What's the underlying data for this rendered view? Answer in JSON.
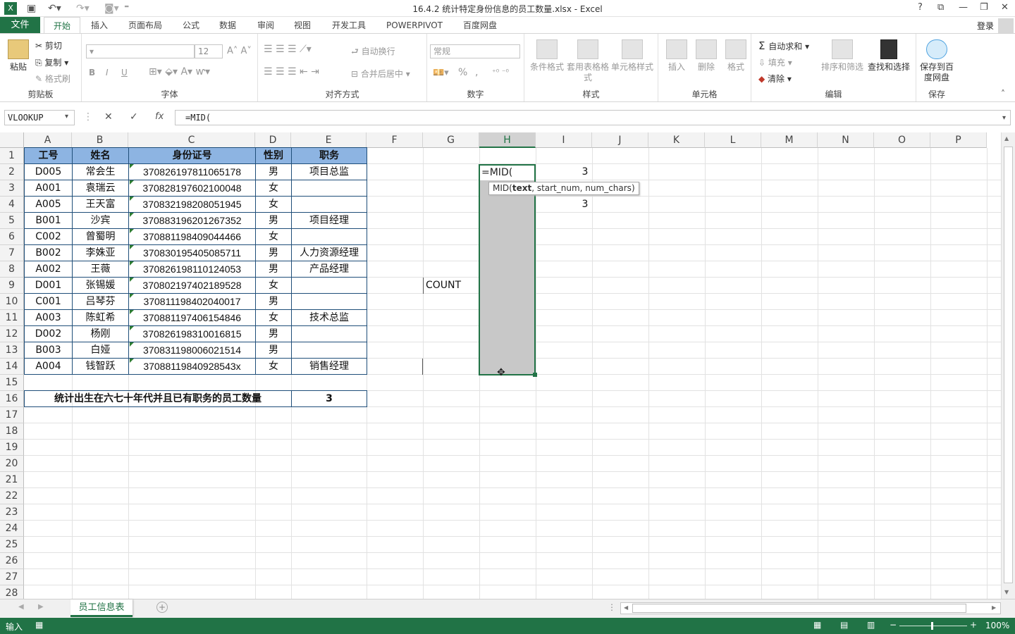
{
  "app": {
    "title": "16.4.2 统计特定身份信息的员工数量.xlsx - Excel",
    "window_buttons": [
      "?",
      "⧉",
      "—",
      "❐",
      "✕"
    ],
    "login": "登录"
  },
  "tabs": [
    "文件",
    "开始",
    "插入",
    "页面布局",
    "公式",
    "数据",
    "审阅",
    "视图",
    "开发工具",
    "POWERPIVOT",
    "百度网盘"
  ],
  "ribbon": {
    "clipboard": {
      "paste": "粘贴",
      "cut": "剪切",
      "copy": "复制",
      "format_painter": "格式刷",
      "label": "剪贴板"
    },
    "font": {
      "size": "12",
      "label": "字体",
      "bold": "B",
      "italic": "I",
      "underline": "U"
    },
    "alignment": {
      "wrap": "自动换行",
      "merge": "合并后居中",
      "label": "对齐方式"
    },
    "number": {
      "format": "常规",
      "percent": "%",
      "comma": ",",
      "label": "数字"
    },
    "styles": {
      "conditional": "条件格式",
      "table": "套用表格格式",
      "cell_styles": "单元格样式",
      "label": "样式"
    },
    "cells": {
      "insert": "插入",
      "delete": "删除",
      "format": "格式",
      "label": "单元格"
    },
    "editing": {
      "autosum": "自动求和",
      "fill": "填充",
      "clear": "清除",
      "sort": "排序和筛选",
      "find": "查找和选择",
      "label": "编辑"
    },
    "save": {
      "save_to": "保存到百度网盘",
      "label": "保存"
    }
  },
  "formula_bar": {
    "name_box": "VLOOKUP",
    "content": "=MID(",
    "fx": "fx"
  },
  "columns": [
    "A",
    "B",
    "C",
    "D",
    "E",
    "F",
    "G",
    "H",
    "I",
    "J",
    "K",
    "L",
    "M",
    "N",
    "O",
    "P"
  ],
  "rows": [
    "1",
    "2",
    "3",
    "4",
    "5",
    "6",
    "7",
    "8",
    "9",
    "10",
    "11",
    "12",
    "13",
    "14",
    "15",
    "16",
    "17",
    "18",
    "19",
    "20",
    "21",
    "22",
    "23",
    "24",
    "25",
    "26",
    "27",
    "28"
  ],
  "table": {
    "headers": [
      "工号",
      "姓名",
      "身份证号",
      "性别",
      "职务"
    ],
    "rows": [
      [
        "D005",
        "常会生",
        "370826197811065178",
        "男",
        "项目总监"
      ],
      [
        "A001",
        "袁瑞云",
        "370828197602100048",
        "女",
        ""
      ],
      [
        "A005",
        "王天富",
        "370832198208051945",
        "女",
        ""
      ],
      [
        "B001",
        "沙宾",
        "370883196201267352",
        "男",
        "项目经理"
      ],
      [
        "C002",
        "曾蜀明",
        "370881198409044466",
        "女",
        ""
      ],
      [
        "B002",
        "李姝亚",
        "370830195405085711",
        "男",
        "人力资源经理"
      ],
      [
        "A002",
        "王薇",
        "370826198110124053",
        "男",
        "产品经理"
      ],
      [
        "D001",
        "张锡媛",
        "370802197402189528",
        "女",
        ""
      ],
      [
        "C001",
        "吕琴芬",
        "370811198402040017",
        "男",
        ""
      ],
      [
        "A003",
        "陈虹希",
        "370881197406154846",
        "女",
        "技术总监"
      ],
      [
        "D002",
        "杨刚",
        "370826198310016815",
        "男",
        ""
      ],
      [
        "B003",
        "白娅",
        "370831198006021514",
        "男",
        ""
      ],
      [
        "A004",
        "钱智跃",
        "37088119840928543x",
        "女",
        "销售经理"
      ]
    ]
  },
  "summary": {
    "label": "统计出生在六七十年代并且已有职务的员工数量",
    "value": "3"
  },
  "extra_cells": {
    "g9": "COUNT",
    "h2": "=MID(",
    "i2": "3",
    "i4": "3"
  },
  "tooltip": {
    "fn": "MID(",
    "arg1": "text",
    "rest": ", start_num, num_chars)"
  },
  "sheet_tab": "员工信息表",
  "status": {
    "mode": "输入",
    "zoom": "100%"
  }
}
